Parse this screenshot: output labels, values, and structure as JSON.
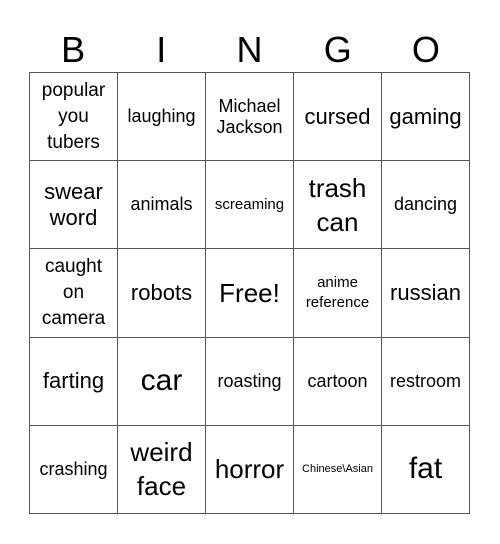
{
  "header": {
    "letters": [
      "B",
      "I",
      "N",
      "G",
      "O"
    ]
  },
  "cells": [
    {
      "text": "popular you tubers",
      "size": "s-md2"
    },
    {
      "text": "laughing",
      "size": "s-md"
    },
    {
      "text": "Michael Jackson",
      "size": "s-md"
    },
    {
      "text": "cursed",
      "size": "s-lg"
    },
    {
      "text": "gaming",
      "size": "s-lg"
    },
    {
      "text": "swear word",
      "size": "s-lg"
    },
    {
      "text": "animals",
      "size": "s-md"
    },
    {
      "text": "screaming",
      "size": "s-sm"
    },
    {
      "text": "trash can",
      "size": "s-xl"
    },
    {
      "text": "dancing",
      "size": "s-md"
    },
    {
      "text": "caught on camera",
      "size": "s-md2"
    },
    {
      "text": "robots",
      "size": "s-lg"
    },
    {
      "text": "Free!",
      "size": "s-xl"
    },
    {
      "text": "anime reference",
      "size": "s-sm"
    },
    {
      "text": "russian",
      "size": "s-lg"
    },
    {
      "text": "farting",
      "size": "s-lg"
    },
    {
      "text": "car",
      "size": "s-xxl"
    },
    {
      "text": "roasting",
      "size": "s-md"
    },
    {
      "text": "cartoon",
      "size": "s-md"
    },
    {
      "text": "restroom",
      "size": "s-md"
    },
    {
      "text": "crashing",
      "size": "s-md"
    },
    {
      "text": "weird face",
      "size": "s-xl"
    },
    {
      "text": "horror",
      "size": "s-xl"
    },
    {
      "text": "Chinese\\Asian",
      "size": "s-xs"
    },
    {
      "text": "fat",
      "size": "s-xxl"
    }
  ]
}
